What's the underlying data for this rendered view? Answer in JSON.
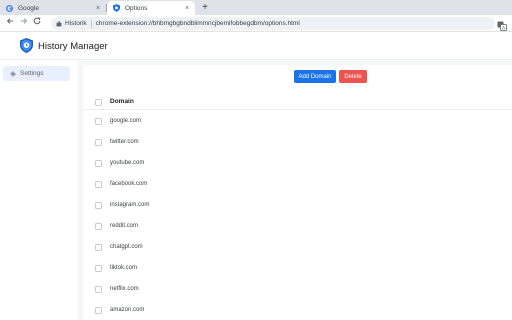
{
  "browser": {
    "tabs": [
      {
        "title": "Google",
        "active": false,
        "favicon": "google-icon"
      },
      {
        "title": "Options",
        "active": true,
        "favicon": "shield-icon"
      }
    ],
    "new_tab_glyph": "+",
    "close_glyph": "×",
    "site_chip": "Historik",
    "url": "chrome-extension://bhbmgbgbndblimmncjbemifobbegdbm/options.html"
  },
  "app": {
    "title": "History Manager",
    "sidebar": [
      {
        "label": "Settings",
        "icon": "gear-icon",
        "active": true
      }
    ],
    "buttons": {
      "add": "Add Domain",
      "delete": "Delete"
    },
    "table": {
      "header": "Domain",
      "rows": [
        "google.com",
        "twitter.com",
        "youtube.com",
        "facebook.com",
        "instagram.com",
        "reddit.com",
        "chatgpt.com",
        "tiktok.com",
        "netflix.com",
        "amazon.com"
      ]
    }
  },
  "colors": {
    "primary": "#1a73e8",
    "danger": "#ef5350",
    "sidebar_active": "#e8f0fe"
  }
}
